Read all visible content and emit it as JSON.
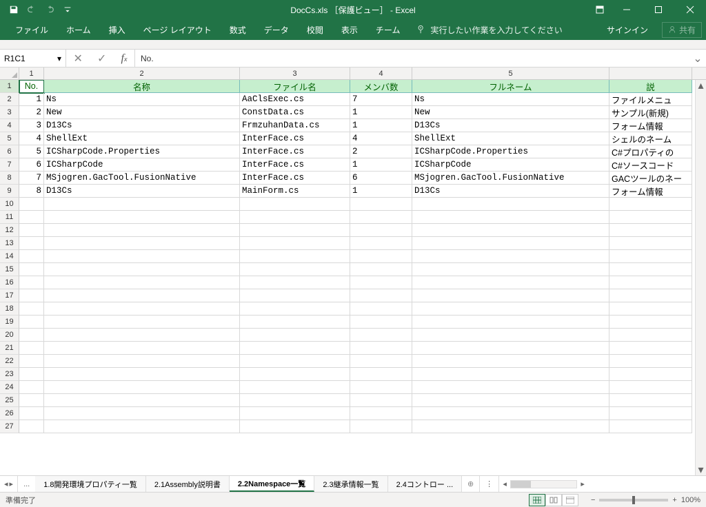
{
  "title": "DocCs.xls ［保護ビュー］ - Excel",
  "qat": {
    "undo_enabled": false,
    "redo_enabled": false
  },
  "ribbon": {
    "tabs": [
      "ファイル",
      "ホーム",
      "挿入",
      "ページ レイアウト",
      "数式",
      "データ",
      "校閲",
      "表示",
      "チーム"
    ],
    "tellme": "実行したい作業を入力してください",
    "signin": "サインイン",
    "share": "共有"
  },
  "namebox": "R1C1",
  "formula": "No.",
  "col_headers": [
    "1",
    "2",
    "3",
    "4",
    "5"
  ],
  "headers": [
    "No.",
    "名称",
    "ファイル名",
    "メンバ数",
    "フルネーム",
    "説"
  ],
  "rows": [
    {
      "no": "1",
      "name": "Ns",
      "file": "AaClsExec.cs",
      "members": "7",
      "full": "Ns",
      "desc": "ファイルメニュ"
    },
    {
      "no": "2",
      "name": "New",
      "file": "ConstData.cs",
      "members": "1",
      "full": "New",
      "desc": "サンプル(新規)"
    },
    {
      "no": "3",
      "name": "D13Cs",
      "file": "FrmzuhanData.cs",
      "members": "1",
      "full": "D13Cs",
      "desc": "フォーム情報"
    },
    {
      "no": "4",
      "name": "ShellExt",
      "file": "InterFace.cs",
      "members": "4",
      "full": "ShellExt",
      "desc": "シェルのネーム"
    },
    {
      "no": "5",
      "name": "ICSharpCode.Properties",
      "file": "InterFace.cs",
      "members": "2",
      "full": "ICSharpCode.Properties",
      "desc": "C#プロパティの"
    },
    {
      "no": "6",
      "name": "ICSharpCode",
      "file": "InterFace.cs",
      "members": "1",
      "full": "ICSharpCode",
      "desc": "C#ソースコード"
    },
    {
      "no": "7",
      "name": "MSjogren.GacTool.FusionNative",
      "file": "InterFace.cs",
      "members": "6",
      "full": "MSjogren.GacTool.FusionNative",
      "desc": "GACツールのネー"
    },
    {
      "no": "8",
      "name": "D13Cs",
      "file": "MainForm.cs",
      "members": "1",
      "full": "D13Cs",
      "desc": "フォーム情報"
    }
  ],
  "empty_rows_start": 10,
  "empty_rows_end": 27,
  "sheet_tabs": {
    "ellipsis": "...",
    "tabs": [
      "1.8開発環境プロパティ一覧",
      "2.1Assembly説明書",
      "2.2Namespace一覧",
      "2.3継承情報一覧",
      "2.4コントロー ..."
    ],
    "active_index": 2
  },
  "status": {
    "ready": "準備完了",
    "zoom": "100%"
  }
}
